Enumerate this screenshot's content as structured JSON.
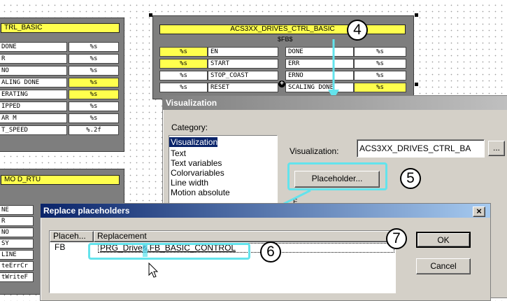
{
  "left_block": {
    "title": "TRL_BASIC",
    "rows": [
      {
        "name": "DONE",
        "fmt": "%s"
      },
      {
        "name": "R",
        "fmt": "%s"
      },
      {
        "name": "NO",
        "fmt": "%s"
      },
      {
        "name": "ALING DONE",
        "fmt": "%s"
      },
      {
        "name": "ERATING",
        "fmt": "%s"
      },
      {
        "name": "IPPED",
        "fmt": "%s"
      },
      {
        "name": "AR M",
        "fmt": "%s"
      },
      {
        "name": "T_SPEED",
        "fmt": "%.2f"
      }
    ]
  },
  "main_block": {
    "title": "ACS3XX_DRIVES_CTRL_BASIC",
    "instance": "$FB$",
    "inputs": [
      {
        "fmt": "%s",
        "name": "EN"
      },
      {
        "fmt": "%s",
        "name": "START"
      },
      {
        "fmt": "%s",
        "name": "STOP_COAST"
      },
      {
        "fmt": "%s",
        "name": "RESET"
      }
    ],
    "outputs": [
      {
        "name": "DONE",
        "fmt": "%s"
      },
      {
        "name": "ERR",
        "fmt": "%s"
      },
      {
        "name": "ERNO",
        "fmt": "%s"
      },
      {
        "name": "SCALING DONE",
        "fmt": "%s"
      }
    ]
  },
  "bottom_block": {
    "title": "MO D_RTU",
    "rows": [
      "NE",
      "R",
      "NO",
      "SY",
      "LINE",
      "teErrCr",
      "tWriteF"
    ]
  },
  "visualization_dialog": {
    "title": "Visualization",
    "category_label": "Category:",
    "categories": [
      "Visualization",
      "Text",
      "Text variables",
      "Colorvariables",
      "Line width",
      "Motion absolute"
    ],
    "selected_category": "Visualization",
    "visualization_label": "Visualization:",
    "visualization_value": "ACS3XX_DRIVES_CTRL_BA",
    "browse_label": "...",
    "placeholder_button": "Placeholder...",
    "partial_label": "F"
  },
  "replace_dialog": {
    "title": "Replace placeholders",
    "close_label": "×",
    "columns": [
      "Placeh...",
      "Replacement"
    ],
    "row": {
      "placeholder": "FB",
      "replacement_before": "PRG_Drive",
      "replacement_highlight": "2",
      "replacement_after": ".FB_BASIC_CONTROL"
    },
    "ok_label": "OK",
    "cancel_label": "Cancel"
  },
  "callouts": [
    "4",
    "5",
    "6",
    "7"
  ],
  "colors": {
    "highlight": "#63e3ec",
    "fb_title": "#ffff4d",
    "title_bar_start": "#0a246a",
    "title_bar_end": "#a6caf0",
    "inactive_title_start": "#808080",
    "inactive_title_end": "#c0c0c0",
    "selection": "#0a246a"
  }
}
